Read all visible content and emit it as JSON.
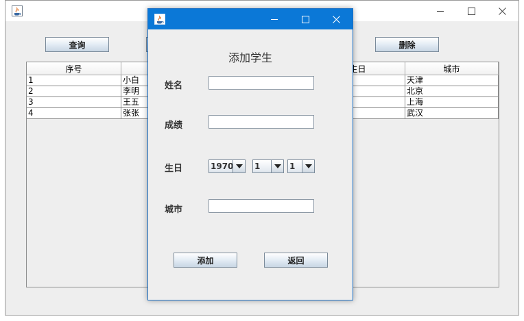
{
  "main_window": {
    "toolbar": {
      "query_label": "查询",
      "delete_label": "删除"
    },
    "table": {
      "columns": [
        "序号",
        "",
        "",
        "生日",
        "城市"
      ],
      "rows": [
        {
          "id": "1",
          "name": "小白",
          "city": "天津"
        },
        {
          "id": "2",
          "name": "李明",
          "city": "北京"
        },
        {
          "id": "3",
          "name": "王五",
          "city": "上海"
        },
        {
          "id": "4",
          "name": "张张",
          "city": "武汉"
        }
      ]
    }
  },
  "dialog": {
    "title": "添加学生",
    "name_label": "姓名",
    "score_label": "成绩",
    "birthday_label": "生日",
    "city_label": "城市",
    "name_value": "",
    "score_value": "",
    "city_value": "",
    "year_value": "1970",
    "month_value": "1",
    "day_value": "1",
    "add_label": "添加",
    "back_label": "返回"
  },
  "colors": {
    "dialog_titlebar": "#0b78d7",
    "window_bg": "#eeeeee"
  },
  "icons": [
    "java-icon",
    "minimize-icon",
    "maximize-icon",
    "close-icon",
    "dropdown-arrow-icon"
  ]
}
